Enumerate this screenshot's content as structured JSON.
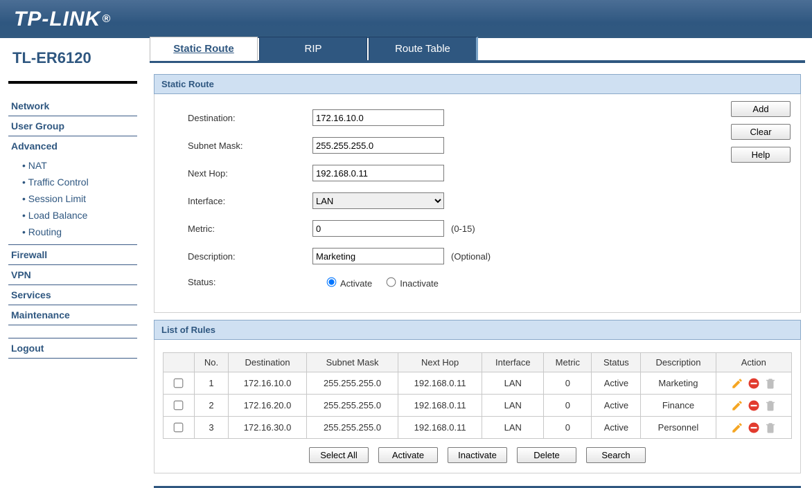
{
  "brand": "TP-LINK",
  "device_model": "TL-ER6120",
  "sidebar": {
    "items": [
      {
        "label": "Network"
      },
      {
        "label": "User Group"
      },
      {
        "label": "Advanced",
        "children": [
          {
            "label": "NAT"
          },
          {
            "label": "Traffic Control"
          },
          {
            "label": "Session Limit"
          },
          {
            "label": "Load Balance"
          },
          {
            "label": "Routing",
            "active": true
          }
        ]
      },
      {
        "label": "Firewall"
      },
      {
        "label": "VPN"
      },
      {
        "label": "Services"
      },
      {
        "label": "Maintenance"
      }
    ],
    "logout": "Logout"
  },
  "tabs": [
    {
      "label": "Static Route",
      "active": true
    },
    {
      "label": "RIP"
    },
    {
      "label": "Route Table"
    }
  ],
  "panel": {
    "title": "Static Route",
    "fields": {
      "destination": {
        "label": "Destination:",
        "value": "172.16.10.0"
      },
      "subnet": {
        "label": "Subnet Mask:",
        "value": "255.255.255.0"
      },
      "nexthop": {
        "label": "Next Hop:",
        "value": "192.168.0.11"
      },
      "interface": {
        "label": "Interface:",
        "value": "LAN"
      },
      "metric": {
        "label": "Metric:",
        "value": "0",
        "hint": "(0-15)"
      },
      "description": {
        "label": "Description:",
        "value": "Marketing",
        "hint": "(Optional)"
      },
      "status": {
        "label": "Status:",
        "activate": "Activate",
        "inactivate": "Inactivate",
        "value": "activate"
      }
    },
    "buttons": {
      "add": "Add",
      "clear": "Clear",
      "help": "Help"
    }
  },
  "rules": {
    "title": "List of Rules",
    "headers": {
      "no": "No.",
      "dest": "Destination",
      "mask": "Subnet Mask",
      "hop": "Next Hop",
      "iface": "Interface",
      "metric": "Metric",
      "status": "Status",
      "desc": "Description",
      "action": "Action"
    },
    "rows": [
      {
        "no": "1",
        "dest": "172.16.10.0",
        "mask": "255.255.255.0",
        "hop": "192.168.0.11",
        "iface": "LAN",
        "metric": "0",
        "status": "Active",
        "desc": "Marketing"
      },
      {
        "no": "2",
        "dest": "172.16.20.0",
        "mask": "255.255.255.0",
        "hop": "192.168.0.11",
        "iface": "LAN",
        "metric": "0",
        "status": "Active",
        "desc": "Finance"
      },
      {
        "no": "3",
        "dest": "172.16.30.0",
        "mask": "255.255.255.0",
        "hop": "192.168.0.11",
        "iface": "LAN",
        "metric": "0",
        "status": "Active",
        "desc": "Personnel"
      }
    ],
    "toolbar": {
      "select_all": "Select All",
      "activate": "Activate",
      "inactivate": "Inactivate",
      "delete": "Delete",
      "search": "Search"
    }
  }
}
